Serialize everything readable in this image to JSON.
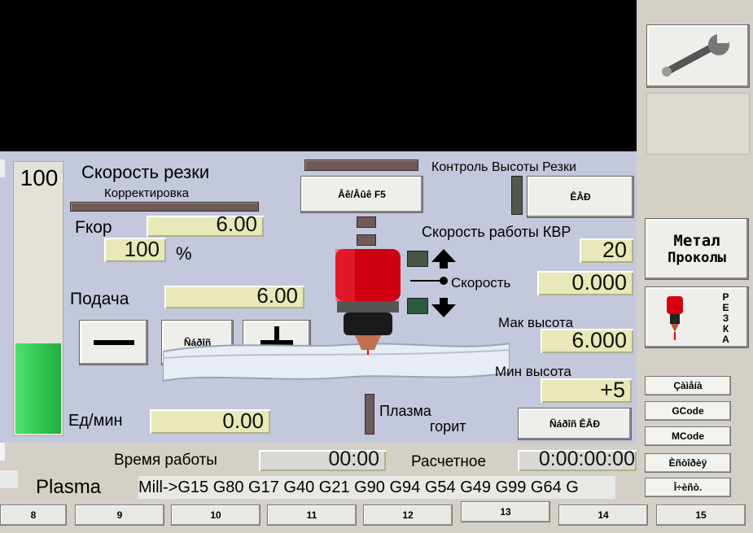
{
  "colors": {
    "screen": "#000000",
    "panel": "#c3c8dc",
    "dro": "#e8e8b8",
    "bar_green": "#22c248"
  },
  "gauge": {
    "value_label": "100",
    "fill_fraction": 0.33
  },
  "speed": {
    "title": "Скорость резки",
    "subtitle": "Корректировка",
    "fkor_label": "Fкор",
    "fkor_value": "6.00",
    "pct_value": "100",
    "pct_unit": "%"
  },
  "feed": {
    "label": "Подача",
    "value": "6.00",
    "unit_label": "Ед/мин",
    "units_value": "0.00",
    "minus_label": "—",
    "reset_label": "Ñáðîñ",
    "plus_label": "+"
  },
  "thc": {
    "title": "Контроль Высоты Резки",
    "toggle_label": "Âê/Âûê F5",
    "thc_btn_label": "ÊÂÐ",
    "speed_title": "Скорость работы КВР",
    "speed_value": "20",
    "rate_value": "0.000",
    "rate_label": "Скорость",
    "max_label": "Мак высота",
    "max_value": "6.000",
    "min_label": "Мин высота",
    "min_value": "+5",
    "reset_btn_label": "Ñáðîñ ÊÂÐ",
    "plasma_line1": "Плазма",
    "plasma_line2": "горит"
  },
  "status": {
    "runtime_label": "Время работы",
    "runtime_value": "00:00",
    "estimate_label": "Расчетное",
    "estimate_value": "0:00:00:00",
    "mode": "Plasma",
    "gcodes": "Mill->G15  G80 G17 G40 G21 G90 G94 G54 G49 G99 G64 G"
  },
  "right": {
    "metal_line1": "Метал",
    "metal_line2": "Проколы",
    "cut_letters": "РЕЗКА",
    "menu": [
      "Çàìåíà",
      "GCode",
      "MCode",
      "Èñòîðèÿ",
      "Î÷èñò."
    ]
  },
  "tabs": [
    "8",
    "9",
    "10",
    "11",
    "12",
    "13",
    "14",
    "15"
  ]
}
